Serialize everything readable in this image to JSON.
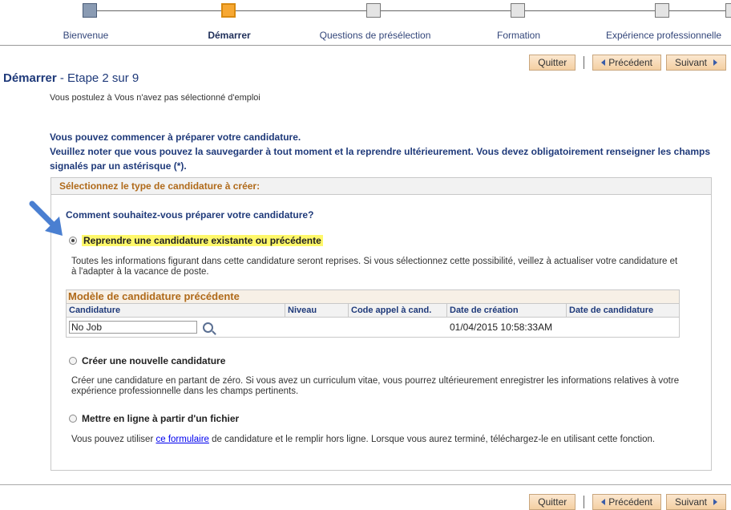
{
  "train": {
    "steps": [
      {
        "label": "Bienvenue",
        "state": "done"
      },
      {
        "label": "Démarrer",
        "state": "current"
      },
      {
        "label": "Questions de présélection",
        "state": "todo"
      },
      {
        "label": "Formation",
        "state": "todo"
      },
      {
        "label": "Expérience professionnelle",
        "state": "todo"
      }
    ]
  },
  "nav": {
    "quit": "Quitter",
    "prev": "Précédent",
    "next": "Suivant"
  },
  "page": {
    "title_main": "Démarrer",
    "title_step": " - Etape 2 sur 9",
    "applying": "Vous postulez à Vous n'avez pas sélectionné d'emploi",
    "intro1": "Vous pouvez commencer à préparer votre candidature.",
    "intro2": "Veuillez noter que vous pouvez la sauvegarder à tout moment et la reprendre ultérieurement. Vous devez obligatoirement renseigner les champs signalés par un astérisque (*)."
  },
  "section": {
    "header": "Sélectionnez le type de candidature à créer:",
    "question": "Comment souhaitez-vous préparer votre candidature?",
    "options": [
      {
        "label": "Reprendre une candidature existante ou précédente",
        "selected": true,
        "desc": "Toutes les informations figurant dans cette candidature seront reprises. Si vous sélectionnez cette possibilité, veillez à actualiser votre candidature et à l'adapter à la vacance de poste."
      },
      {
        "label": "Créer une nouvelle candidature",
        "selected": false,
        "desc": "Créer une candidature en partant de zéro. Si vous avez un curriculum vitae, vous pourrez ultérieurement enregistrer les informations relatives à votre expérience professionnelle dans les champs pertinents."
      },
      {
        "label": "Mettre en ligne à partir d'un fichier",
        "selected": false,
        "desc_pre": "Vous pouvez utiliser ",
        "desc_link": "ce formulaire",
        "desc_post": " de candidature et le remplir hors ligne. Lorsque vous aurez terminé, téléchargez-le en utilisant cette fonction."
      }
    ]
  },
  "grid": {
    "title": "Modèle de candidature précédente",
    "columns": [
      "Candidature",
      "Niveau",
      "Code appel à cand.",
      "Date de création",
      "Date de candidature"
    ],
    "rows": [
      {
        "candidature": "No Job",
        "niveau": "",
        "code": "",
        "creation": "01/04/2015 10:58:33AM",
        "date": ""
      }
    ]
  },
  "colors": {
    "accent": "#f7a833",
    "header_text": "#b06a1a",
    "link": "#1f3a7a"
  }
}
